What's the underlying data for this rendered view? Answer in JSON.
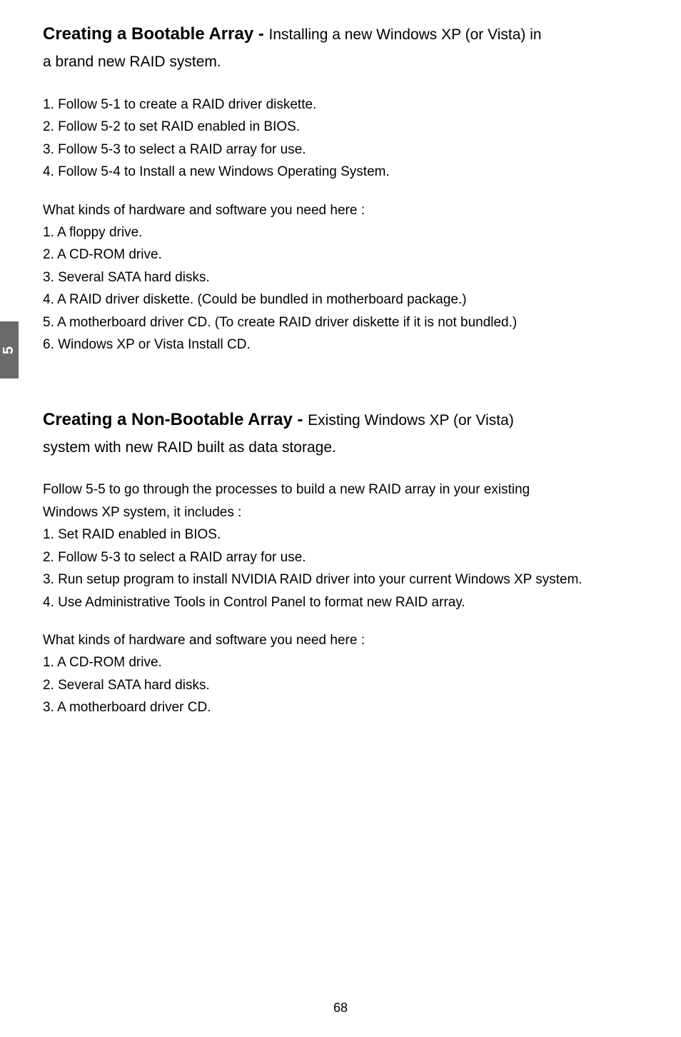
{
  "sideTab": "5",
  "section1": {
    "headingBold": "Creating a Bootable Array - ",
    "headingRest": "Installing a new Windows XP (or Vista) in",
    "subLine": "a brand new RAID system.",
    "steps": [
      "1. Follow 5-1 to create a RAID driver diskette.",
      "2. Follow 5-2 to set RAID enabled in BIOS.",
      "3. Follow 5-3 to select a RAID array for use.",
      "4. Follow 5-4 to Install a new Windows Operating System."
    ],
    "needsIntro": "What kinds of hardware and software you need here :",
    "needs": [
      "1. A floppy drive.",
      "2. A CD-ROM drive.",
      "3. Several SATA hard disks.",
      "4. A RAID driver diskette. (Could be bundled in motherboard package.)",
      "5. A motherboard driver CD. (To create RAID driver diskette if it is not bundled.)",
      "6. Windows XP or Vista Install CD."
    ]
  },
  "section2": {
    "headingBold": "Creating a Non-Bootable Array - ",
    "headingRest": "Existing Windows XP (or Vista)",
    "subLine": "system with new RAID built as data storage.",
    "intro1": "Follow 5-5 to go through the processes to build a new RAID array in your existing",
    "intro2": "Windows XP system, it includes :",
    "steps": [
      "1. Set RAID enabled in BIOS.",
      "2. Follow 5-3 to select a RAID array for use.",
      "3. Run setup program to install NVIDIA RAID driver into your current Windows XP system.",
      "4. Use Administrative Tools in Control Panel to format new RAID array."
    ],
    "needsIntro": "What kinds of hardware and software you need here :",
    "needs": [
      "1. A CD-ROM drive.",
      "2. Several SATA hard disks.",
      "3. A motherboard driver CD."
    ]
  },
  "pageNumber": "68"
}
